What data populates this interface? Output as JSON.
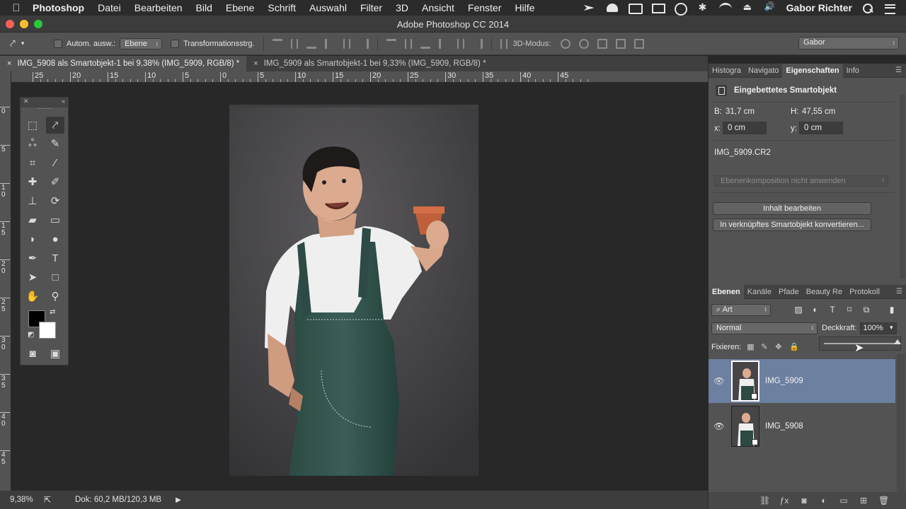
{
  "menubar": {
    "app": "Photoshop",
    "items": [
      "Datei",
      "Bearbeiten",
      "Bild",
      "Ebene",
      "Schrift",
      "Auswahl",
      "Filter",
      "3D",
      "Ansicht",
      "Fenster",
      "Hilfe"
    ],
    "user": "Gabor Richter"
  },
  "window": {
    "title": "Adobe Photoshop CC 2014"
  },
  "options": {
    "auto_select_label": "Autom. ausw.:",
    "auto_select_value": "Ebene",
    "transform_label": "Transformationsstrg.",
    "mode3d_label": "3D-Modus:",
    "workspace": "Gabor"
  },
  "tabs": [
    {
      "label": "IMG_5908 als Smartobjekt-1 bei 9,38% (IMG_5909, RGB/8) *",
      "close": "×"
    },
    {
      "label": "IMG_5909 als Smartobjekt-1 bei 9,33% (IMG_5909, RGB/8) *",
      "close": "×"
    }
  ],
  "ruler": {
    "h": [
      "25",
      "20",
      "15",
      "10",
      "5",
      "0",
      "5",
      "10",
      "15",
      "20",
      "25",
      "30",
      "35",
      "40",
      "45"
    ],
    "v": [
      "0",
      "5",
      "1\n0",
      "1\n5",
      "2\n0",
      "2\n5",
      "3\n0",
      "3\n5",
      "4\n0",
      "4\n5"
    ]
  },
  "status": {
    "zoom": "9,38%",
    "doc": "Dok: 60,2 MB/120,3 MB"
  },
  "properties_panel": {
    "tabs": [
      "Histogra",
      "Navigato",
      "Eigenschaften",
      "Info"
    ],
    "active_tab": "Eigenschaften",
    "title": "Eingebettetes Smartobjekt",
    "b_label": "B:",
    "b_value": "31,7 cm",
    "h_label": "H:",
    "h_value": "47,55 cm",
    "x_label": "x:",
    "x_value": "0 cm",
    "y_label": "y:",
    "y_value": "0 cm",
    "filename": "IMG_5909.CR2",
    "comp_placeholder": "Ebenenkomposition nicht anwenden",
    "edit_button": "Inhalt bearbeiten",
    "convert_button": "In verknüpftes Smartobjekt konvertieren..."
  },
  "layers_panel": {
    "tabs": [
      "Ebenen",
      "Kanäle",
      "Pfade",
      "Beauty Re",
      "Protokoll"
    ],
    "active_tab": "Ebenen",
    "filter_kind": "Art",
    "blend_mode": "Normal",
    "opacity_label": "Deckkraft:",
    "opacity_value": "100%",
    "opacity_fraction": 1.0,
    "lock_label": "Fixieren:",
    "layers": [
      {
        "name": "IMG_5909",
        "selected": true
      },
      {
        "name": "IMG_5908",
        "selected": false
      }
    ]
  },
  "colors": {
    "foreground": "#000000",
    "background": "#ffffff",
    "selected_layer": "#6c80a0"
  }
}
